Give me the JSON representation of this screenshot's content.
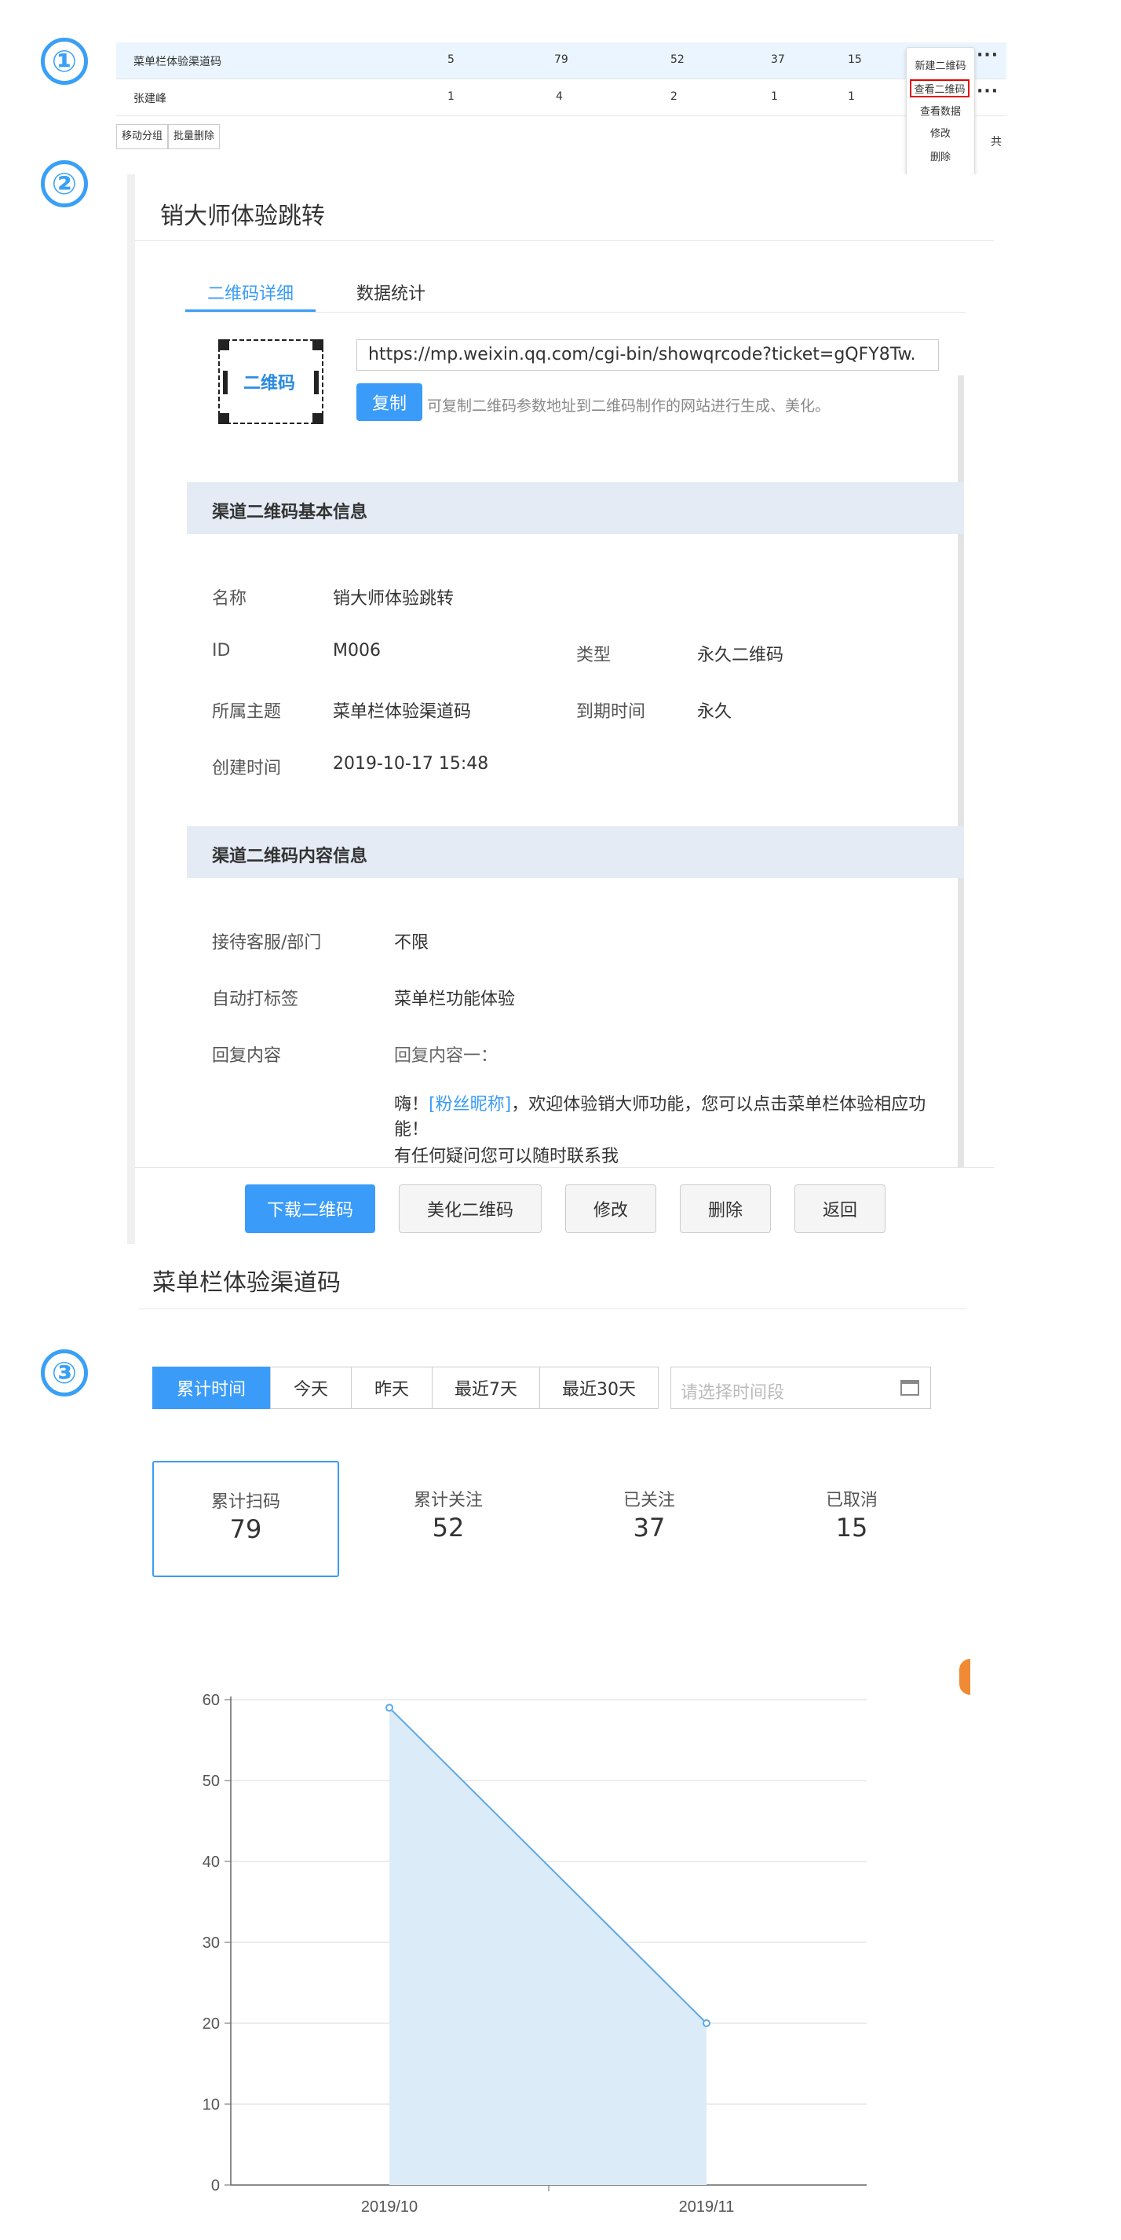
{
  "steps": [
    "①",
    "②",
    "③"
  ],
  "table": {
    "rows": [
      {
        "name": "菜单栏体验渠道码",
        "c1": "5",
        "c2": "79",
        "c3": "52",
        "c4": "37",
        "c5": "15"
      },
      {
        "name": "张建峰",
        "c1": "1",
        "c2": "4",
        "c3": "2",
        "c4": "1",
        "c5": "1"
      }
    ],
    "buttons": [
      "移动分组",
      "批量删除"
    ],
    "more_icon": "ellipsis-icon",
    "right_text": "共"
  },
  "dropdown": {
    "items": [
      "新建二维码",
      "查看二维码",
      "查看数据",
      "修改",
      "删除"
    ],
    "highlight_color": "#e60000"
  },
  "detail": {
    "title": "销大师体验跳转",
    "tabs": [
      "二维码详细",
      "数据统计"
    ],
    "qr_label": "二维码",
    "url": "https://mp.weixin.qq.com/cgi-bin/showqrcode?ticket=gQFY8Tw.",
    "copy_label": "复制",
    "copy_hint": "可复制二维码参数地址到二维码制作的网站进行生成、美化。",
    "basic_header": "渠道二维码基本信息",
    "basic": {
      "name_label": "名称",
      "name": "销大师体验跳转",
      "id_label": "ID",
      "id": "M006",
      "type_label": "类型",
      "type": "永久二维码",
      "topic_label": "所属主题",
      "topic": "菜单栏体验渠道码",
      "expire_label": "到期时间",
      "expire": "永久",
      "created_label": "创建时间",
      "created": "2019-10-17 15:48"
    },
    "content_header": "渠道二维码内容信息",
    "content": {
      "agent_label": "接待客服/部门",
      "agent": "不限",
      "tag_label": "自动打标签",
      "tag": "菜单栏功能体验",
      "reply_label": "回复内容",
      "reply_title": "回复内容一：",
      "reply_pre": "嗨！",
      "reply_link": "[粉丝昵称]",
      "reply_post": "，欢迎体验销大师功能，您可以点击菜单栏体验相应功",
      "reply_line2": "能！",
      "reply_line3": "有任何疑问您可以随时联系我"
    },
    "buttons": [
      "下载二维码",
      "美化二维码",
      "修改",
      "删除",
      "返回"
    ],
    "accent": "#3a9cf8"
  },
  "stats": {
    "title": "菜单栏体验渠道码",
    "ranges": [
      "累计时间",
      "今天",
      "昨天",
      "最近7天",
      "最近30天"
    ],
    "date_placeholder": "请选择时间段",
    "calendar_icon": "calendar-icon",
    "cards": [
      {
        "label": "累计扫码",
        "value": "79"
      },
      {
        "label": "累计关注",
        "value": "52"
      },
      {
        "label": "已关注",
        "value": "37"
      },
      {
        "label": "已取消",
        "value": "15"
      }
    ]
  },
  "chart_data": {
    "type": "area",
    "x": [
      "2019/10",
      "2019/11"
    ],
    "series": [
      {
        "values": [
          59,
          20
        ]
      }
    ],
    "ylim": [
      0,
      60
    ],
    "yticks": [
      "0",
      "10",
      "20",
      "30",
      "40",
      "50",
      "60"
    ],
    "grid": true,
    "line_color": "#5aa9e8",
    "fill_color": "#dcebf8"
  }
}
